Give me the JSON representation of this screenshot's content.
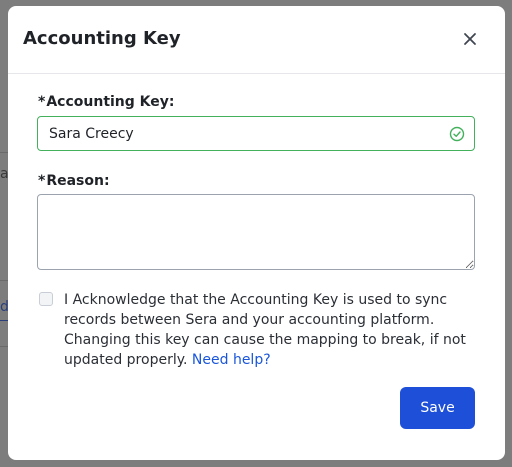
{
  "background": {
    "fragment_1": "a",
    "fragment_2": "d"
  },
  "modal": {
    "title": "Accounting Key",
    "close_icon": "close-icon"
  },
  "form": {
    "accounting_key": {
      "required_mark": "*",
      "label": "Accounting Key:",
      "value": "Sara Creecy",
      "status_icon": "check-circle-icon",
      "status_color": "#43b05c"
    },
    "reason": {
      "required_mark": "*",
      "label": "Reason:",
      "value": ""
    },
    "acknowledge": {
      "checked": false,
      "text": "I Acknowledge that the Accounting Key is used to sync records between Sera and your accounting platform. Changing this key can cause the mapping to break, if not updated properly.",
      "link_text": "Need help?"
    }
  },
  "actions": {
    "save_label": "Save"
  },
  "colors": {
    "primary": "#1d4fd8",
    "link": "#1a56db",
    "success": "#43b05c",
    "overlay": "#7d7d7d"
  }
}
